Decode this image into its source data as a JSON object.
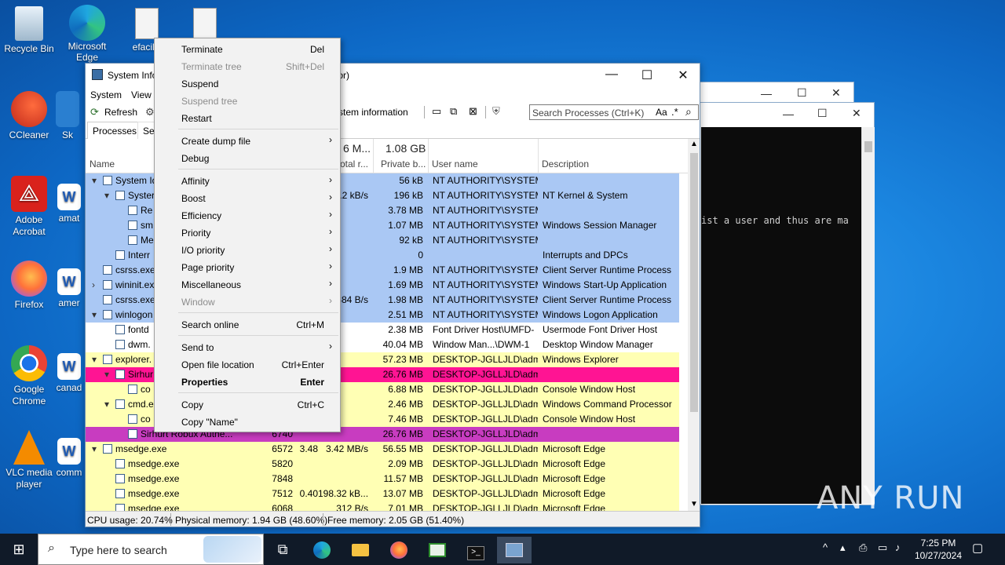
{
  "desktop": {
    "icons": [
      {
        "label": "Recycle Bin",
        "icon": "recycle-bin-icon"
      },
      {
        "label": "Microsoft Edge",
        "icon": "edge-icon"
      },
      {
        "label": "efaciliti",
        "icon": "file-icon"
      },
      {
        "label": "CCleaner",
        "icon": "ccleaner-icon"
      },
      {
        "label": "Sk",
        "icon": "app-icon"
      },
      {
        "label": "Adobe Acrobat",
        "icon": "acrobat-icon"
      },
      {
        "label": "amat",
        "icon": "word-icon"
      },
      {
        "label": "Firefox",
        "icon": "firefox-icon"
      },
      {
        "label": "amer",
        "icon": "word-icon"
      },
      {
        "label": "Google Chrome",
        "icon": "chrome-icon"
      },
      {
        "label": "canad",
        "icon": "word-icon"
      },
      {
        "label": "VLC media player",
        "icon": "vlc-icon"
      },
      {
        "label": "comm",
        "icon": "word-icon"
      }
    ]
  },
  "console": {
    "text": "ist a user and thus are ma"
  },
  "window": {
    "title_part1": "System Info",
    "title_part2": "tor)",
    "menu": {
      "system": "System",
      "view": "View"
    },
    "toolbar": {
      "refresh": "Refresh",
      "sysinfo": "stem information"
    },
    "search_placeholder": "Search Processes (Ctrl+K)",
    "search_aa": "Aa",
    "tabs": {
      "processes": "Processes",
      "services": "Ser"
    },
    "header": {
      "name": "Name",
      "io_top": "6 M...",
      "io_bottom": "otal r...",
      "priv_top": "1.08 GB",
      "priv_bottom": "Private b...",
      "user": "User name",
      "desc": "Description"
    },
    "rows": [
      {
        "indent": 0,
        "expander": "▾",
        "name": "System Id",
        "pid": "",
        "cpu": "",
        "io": "",
        "priv": "56 kB",
        "user": "NT AUTHORITY\\SYSTEM",
        "desc": "",
        "color": "#aac8f4"
      },
      {
        "indent": 1,
        "expander": "▾",
        "name": "Syster",
        "pid": "",
        "cpu": "",
        "io": ".2 kB/s",
        "priv": "196 kB",
        "user": "NT AUTHORITY\\SYSTEM",
        "desc": "NT Kernel & System",
        "color": "#aac8f4"
      },
      {
        "indent": 2,
        "expander": "",
        "name": "Re",
        "pid": "",
        "cpu": "",
        "io": "",
        "priv": "3.78 MB",
        "user": "NT AUTHORITY\\SYSTEM",
        "desc": "",
        "color": "#aac8f4"
      },
      {
        "indent": 2,
        "expander": "",
        "name": "sm",
        "pid": "",
        "cpu": "",
        "io": "",
        "priv": "1.07 MB",
        "user": "NT AUTHORITY\\SYSTEM",
        "desc": "Windows Session Manager",
        "color": "#aac8f4"
      },
      {
        "indent": 2,
        "expander": "",
        "name": "Me",
        "pid": "",
        "cpu": "",
        "io": "",
        "priv": "92 kB",
        "user": "NT AUTHORITY\\SYSTEM",
        "desc": "",
        "color": "#aac8f4"
      },
      {
        "indent": 1,
        "expander": "",
        "name": "Interr",
        "pid": "",
        "cpu": "",
        "io": "",
        "priv": "0",
        "user": "",
        "desc": "Interrupts and DPCs",
        "color": "#aac8f4"
      },
      {
        "indent": 0,
        "expander": "",
        "name": "csrss.exe",
        "pid": "",
        "cpu": "",
        "io": "",
        "priv": "1.9 MB",
        "user": "NT AUTHORITY\\SYSTEM",
        "desc": "Client Server Runtime Process",
        "color": "#aac8f4"
      },
      {
        "indent": 0,
        "expander": "›",
        "name": "wininit.ex",
        "pid": "",
        "cpu": "",
        "io": "",
        "priv": "1.69 MB",
        "user": "NT AUTHORITY\\SYSTEM",
        "desc": "Windows Start-Up Application",
        "color": "#aac8f4"
      },
      {
        "indent": 0,
        "expander": "",
        "name": "csrss.exe",
        "pid": "",
        "cpu": "",
        "io": "384 B/s",
        "priv": "1.98 MB",
        "user": "NT AUTHORITY\\SYSTEM",
        "desc": "Client Server Runtime Process",
        "color": "#aac8f4"
      },
      {
        "indent": 0,
        "expander": "▾",
        "name": "winlogon",
        "pid": "",
        "cpu": "",
        "io": "",
        "priv": "2.51 MB",
        "user": "NT AUTHORITY\\SYSTEM",
        "desc": "Windows Logon Application",
        "color": "#aac8f4"
      },
      {
        "indent": 1,
        "expander": "",
        "name": "fontd",
        "pid": "",
        "cpu": "",
        "io": "",
        "priv": "2.38 MB",
        "user": "Font Driver Host\\UMFD-",
        "desc": "Usermode Font Driver Host",
        "color": "#ffffff"
      },
      {
        "indent": 1,
        "expander": "",
        "name": "dwm.",
        "pid": "",
        "cpu": "",
        "io": "",
        "priv": "40.04 MB",
        "user": "Window Man...\\DWM-1",
        "desc": "Desktop Window Manager",
        "color": "#ffffff"
      },
      {
        "indent": 0,
        "expander": "▾",
        "name": "explorer.",
        "pid": "",
        "cpu": "",
        "io": "",
        "priv": "57.23 MB",
        "user": "DESKTOP-JGLLJLD\\admi",
        "desc": "Windows Explorer",
        "color": "#ffffb4"
      },
      {
        "indent": 1,
        "expander": "▾",
        "name": "Sirhur",
        "pid": "",
        "cpu": "",
        "io": "",
        "priv": "26.76 MB",
        "user": "DESKTOP-JGLLJLD\\admi",
        "desc": "",
        "color": "#ff1493"
      },
      {
        "indent": 2,
        "expander": "",
        "name": "co",
        "pid": "",
        "cpu": "",
        "io": "",
        "priv": "6.88 MB",
        "user": "DESKTOP-JGLLJLD\\admi",
        "desc": "Console Window Host",
        "color": "#ffffb4"
      },
      {
        "indent": 1,
        "expander": "▾",
        "name": "cmd.e",
        "pid": "",
        "cpu": "",
        "io": "",
        "priv": "2.46 MB",
        "user": "DESKTOP-JGLLJLD\\admi",
        "desc": "Windows Command Processor",
        "color": "#ffffb4"
      },
      {
        "indent": 2,
        "expander": "",
        "name": "co",
        "pid": "",
        "cpu": "",
        "io": "",
        "priv": "7.46 MB",
        "user": "DESKTOP-JGLLJLD\\admi",
        "desc": "Console Window Host",
        "color": "#ffffb4"
      },
      {
        "indent": 2,
        "expander": "",
        "name": "Sirhurt Robux Authe...",
        "pid": "6740",
        "cpu": "",
        "io": "",
        "priv": "26.76 MB",
        "user": "DESKTOP-JGLLJLD\\admi",
        "desc": "",
        "color": "#c83cc0"
      },
      {
        "indent": 0,
        "expander": "▾",
        "name": "msedge.exe",
        "pid": "6572",
        "cpu": "3.48",
        "io": "3.42 MB/s",
        "priv": "56.55 MB",
        "user": "DESKTOP-JGLLJLD\\admi",
        "desc": "Microsoft Edge",
        "color": "#ffffb4"
      },
      {
        "indent": 1,
        "expander": "",
        "name": "msedge.exe",
        "pid": "5820",
        "cpu": "",
        "io": "",
        "priv": "2.09 MB",
        "user": "DESKTOP-JGLLJLD\\admi",
        "desc": "Microsoft Edge",
        "color": "#ffffb4"
      },
      {
        "indent": 1,
        "expander": "",
        "name": "msedge.exe",
        "pid": "7848",
        "cpu": "",
        "io": "",
        "priv": "11.57 MB",
        "user": "DESKTOP-JGLLJLD\\admi",
        "desc": "Microsoft Edge",
        "color": "#ffffb4"
      },
      {
        "indent": 1,
        "expander": "",
        "name": "msedge.exe",
        "pid": "7512",
        "cpu": "0.40",
        "io": "198.32 kB...",
        "priv": "13.07 MB",
        "user": "DESKTOP-JGLLJLD\\admi",
        "desc": "Microsoft Edge",
        "color": "#ffffb4"
      },
      {
        "indent": 1,
        "expander": "",
        "name": "msedge.exe",
        "pid": "6068",
        "cpu": "",
        "io": "312 B/s",
        "priv": "7.01 MB",
        "user": "DESKTOP-JGLLJLD\\admi",
        "desc": "Microsoft Edge",
        "color": "#ffffb4"
      }
    ],
    "status": {
      "cpu": "CPU usage: 20.74%",
      "phys": "Physical memory: 1.94 GB (48.60%)",
      "free": "Free memory: 2.05 GB (51.40%)"
    }
  },
  "context_menu": {
    "items": [
      {
        "label": "Terminate",
        "shortcut": "Del",
        "submenu": false,
        "disabled": false,
        "bold": false
      },
      {
        "label": "Terminate tree",
        "shortcut": "Shift+Del",
        "submenu": false,
        "disabled": true,
        "bold": false
      },
      {
        "label": "Suspend",
        "shortcut": "",
        "submenu": false,
        "disabled": false,
        "bold": false
      },
      {
        "label": "Suspend tree",
        "shortcut": "",
        "submenu": false,
        "disabled": true,
        "bold": false
      },
      {
        "label": "Restart",
        "shortcut": "",
        "submenu": false,
        "disabled": false,
        "bold": false
      },
      {
        "sep": true
      },
      {
        "label": "Create dump file",
        "shortcut": "",
        "submenu": true,
        "disabled": false,
        "bold": false
      },
      {
        "label": "Debug",
        "shortcut": "",
        "submenu": false,
        "disabled": false,
        "bold": false
      },
      {
        "sep": true
      },
      {
        "label": "Affinity",
        "shortcut": "",
        "submenu": true,
        "disabled": false,
        "bold": false
      },
      {
        "label": "Boost",
        "shortcut": "",
        "submenu": true,
        "disabled": false,
        "bold": false
      },
      {
        "label": "Efficiency",
        "shortcut": "",
        "submenu": true,
        "disabled": false,
        "bold": false
      },
      {
        "label": "Priority",
        "shortcut": "",
        "submenu": true,
        "disabled": false,
        "bold": false
      },
      {
        "label": "I/O priority",
        "shortcut": "",
        "submenu": true,
        "disabled": false,
        "bold": false
      },
      {
        "label": "Page priority",
        "shortcut": "",
        "submenu": true,
        "disabled": false,
        "bold": false
      },
      {
        "label": "Miscellaneous",
        "shortcut": "",
        "submenu": true,
        "disabled": false,
        "bold": false
      },
      {
        "label": "Window",
        "shortcut": "",
        "submenu": true,
        "disabled": true,
        "bold": false
      },
      {
        "sep": true
      },
      {
        "label": "Search online",
        "shortcut": "Ctrl+M",
        "submenu": false,
        "disabled": false,
        "bold": false
      },
      {
        "sep": true
      },
      {
        "label": "Send to",
        "shortcut": "",
        "submenu": true,
        "disabled": false,
        "bold": false
      },
      {
        "label": "Open file location",
        "shortcut": "Ctrl+Enter",
        "submenu": false,
        "disabled": false,
        "bold": false
      },
      {
        "label": "Properties",
        "shortcut": "Enter",
        "submenu": false,
        "disabled": false,
        "bold": true
      },
      {
        "sep": true
      },
      {
        "label": "Copy",
        "shortcut": "Ctrl+C",
        "submenu": false,
        "disabled": false,
        "bold": false
      },
      {
        "label": "Copy \"Name\"",
        "shortcut": "",
        "submenu": false,
        "disabled": false,
        "bold": false
      }
    ]
  },
  "taskbar": {
    "search_placeholder": "Type here to search",
    "time": "7:25 PM",
    "date": "10/27/2024"
  },
  "watermark": "ANY RUN"
}
